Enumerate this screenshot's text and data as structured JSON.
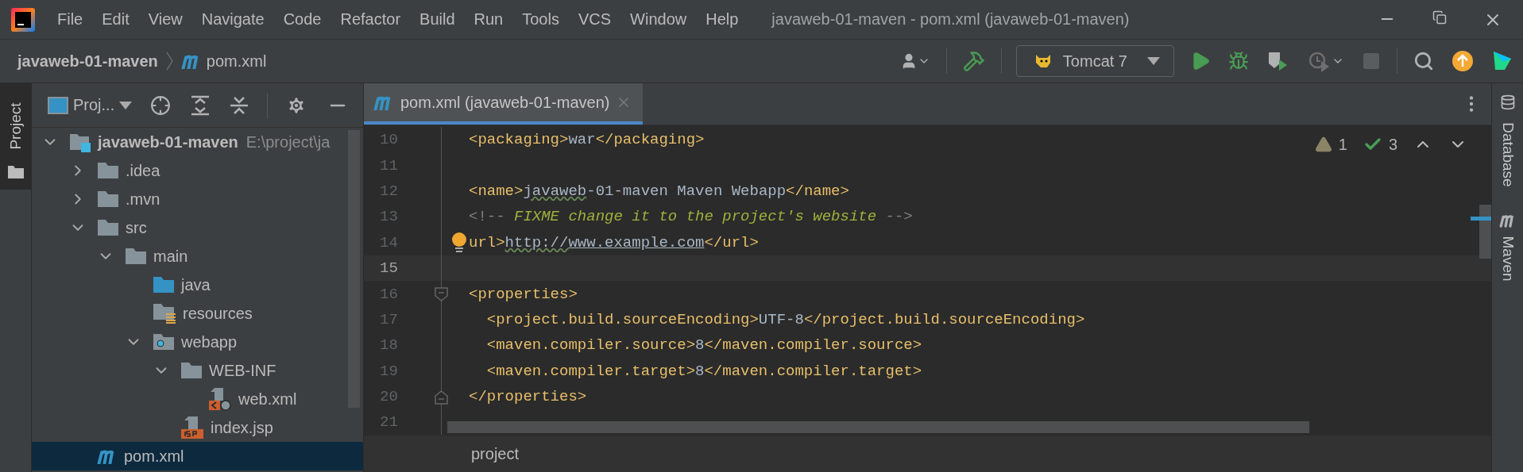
{
  "menu_bar": {
    "items": [
      {
        "label": "File"
      },
      {
        "label": "Edit"
      },
      {
        "label": "View"
      },
      {
        "label": "Navigate"
      },
      {
        "label": "Code"
      },
      {
        "label": "Refactor"
      },
      {
        "label": "Build"
      },
      {
        "label": "Run"
      },
      {
        "label": "Tools"
      },
      {
        "label": "VCS"
      },
      {
        "label": "Window"
      },
      {
        "label": "Help"
      }
    ],
    "window_title": "javaweb-01-maven - pom.xml (javaweb-01-maven)"
  },
  "nav_bar": {
    "breadcrumbs": [
      {
        "label": "javaweb-01-maven",
        "kind": "project"
      },
      {
        "label": "pom.xml",
        "kind": "maven"
      }
    ],
    "run_config": "Tomcat 7",
    "stop_disabled": true
  },
  "left_stripe": {
    "tabs": [
      {
        "label": "Project",
        "selected": true
      }
    ]
  },
  "project_panel": {
    "view_label": "Proj...",
    "tree": [
      {
        "label": "javaweb-01-maven",
        "path": "E:\\project\\ja",
        "kind": "module",
        "expanded": true,
        "selected": false,
        "children": [
          {
            "label": ".idea",
            "kind": "folder",
            "expanded": false,
            "selected": false
          },
          {
            "label": ".mvn",
            "kind": "folder",
            "expanded": false,
            "selected": false
          },
          {
            "label": "src",
            "kind": "folder",
            "expanded": true,
            "selected": false,
            "children": [
              {
                "label": "main",
                "kind": "folder",
                "expanded": true,
                "selected": false,
                "children": [
                  {
                    "label": "java",
                    "kind": "source",
                    "selected": false
                  },
                  {
                    "label": "resources",
                    "kind": "resources",
                    "selected": false
                  },
                  {
                    "label": "webapp",
                    "kind": "web",
                    "expanded": true,
                    "selected": false,
                    "children": [
                      {
                        "label": "WEB-INF",
                        "kind": "folder",
                        "expanded": true,
                        "selected": false,
                        "children": [
                          {
                            "label": "web.xml",
                            "kind": "xml",
                            "selected": false
                          }
                        ]
                      },
                      {
                        "label": "index.jsp",
                        "kind": "jsp",
                        "selected": false
                      }
                    ]
                  }
                ]
              }
            ]
          },
          {
            "label": "pom.xml",
            "kind": "maven",
            "selected": true
          }
        ]
      }
    ]
  },
  "editor": {
    "tabs": [
      {
        "label": "pom.xml (javaweb-01-maven)",
        "selected": true
      }
    ],
    "inspections": {
      "warnings": "1",
      "weak_warnings": "3"
    },
    "lines": [
      {
        "number": "10",
        "current": false,
        "segments": [
          {
            "kind": "tag",
            "text": "<packaging>"
          },
          {
            "kind": "value",
            "text": "war"
          },
          {
            "kind": "tag",
            "text": "</packaging>"
          }
        ]
      },
      {
        "number": "11",
        "current": false
      },
      {
        "number": "12",
        "current": false,
        "segments": [
          {
            "kind": "tag",
            "text": "<name>"
          },
          {
            "kind": "typo",
            "text": "javaweb"
          },
          {
            "kind": "value",
            "text": "-01-maven Maven Webapp"
          },
          {
            "kind": "tag",
            "text": "</name>"
          }
        ]
      },
      {
        "number": "13",
        "current": false,
        "segments": [
          {
            "kind": "comment_mark",
            "text": "<!-- "
          },
          {
            "kind": "comment",
            "text": "FIXME change it to the project's website"
          },
          {
            "kind": "comment_mark",
            "text": " -->"
          }
        ]
      },
      {
        "number": "14",
        "current": false,
        "bulb": true,
        "segments": [
          {
            "kind": "tag",
            "text": "url>"
          },
          {
            "kind": "typo",
            "text": "http://"
          },
          {
            "kind": "link",
            "text": "www.example.com"
          },
          {
            "kind": "tag",
            "text": "</url>"
          }
        ]
      },
      {
        "number": "15",
        "current": true
      },
      {
        "number": "16",
        "current": false,
        "fold_start": true,
        "segments": [
          {
            "kind": "tag",
            "text": "<properties>"
          }
        ]
      },
      {
        "number": "17",
        "current": false,
        "segments": [
          {
            "kind": "tag",
            "text": "  <project.build.sourceEncoding>"
          },
          {
            "kind": "value",
            "text": "UTF-8"
          },
          {
            "kind": "tag",
            "text": "</project.build.sourceEncoding>"
          }
        ]
      },
      {
        "number": "18",
        "current": false,
        "segments": [
          {
            "kind": "tag",
            "text": "  <maven.compiler.source>"
          },
          {
            "kind": "value",
            "text": "8"
          },
          {
            "kind": "tag",
            "text": "</maven.compiler.source>"
          }
        ]
      },
      {
        "number": "19",
        "current": false,
        "segments": [
          {
            "kind": "tag",
            "text": "  <maven.compiler.target>"
          },
          {
            "kind": "value",
            "text": "8"
          },
          {
            "kind": "tag",
            "text": "</maven.compiler.target>"
          }
        ]
      },
      {
        "number": "20",
        "current": false,
        "fold_end": true,
        "segments": [
          {
            "kind": "tag",
            "text": "</properties>"
          }
        ]
      },
      {
        "number": "21",
        "current": false
      }
    ],
    "breadcrumb": "project"
  },
  "right_stripe": {
    "tabs": [
      {
        "label": "Database",
        "kind": "database",
        "selected": false
      },
      {
        "label": "Maven",
        "kind": "maven",
        "selected": false
      }
    ]
  }
}
